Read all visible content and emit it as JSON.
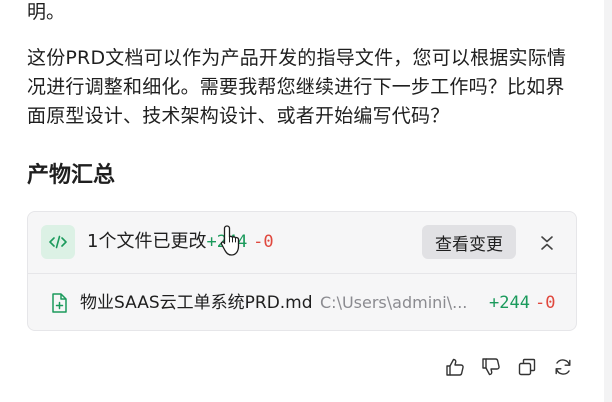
{
  "message": {
    "line_top": "明。",
    "paragraph": "这份PRD文档可以作为产品开发的指导文件，您可以根据实际情况进行调整和细化。需要我帮您继续进行下一步工作吗？比如界面原型设计、技术架构设计、或者开始编写代码？",
    "heading": "产物汇总"
  },
  "card": {
    "summary_text": "1个文件已更改",
    "additions": "+244",
    "deletions": "-0",
    "view_changes_label": "查看变更",
    "icons": {
      "badge": "code-icon",
      "collapse": "chevrons-collapse-icon"
    }
  },
  "files": [
    {
      "name": "物业SAAS云工单系统PRD.md",
      "path": "C:\\Users\\admini\\...",
      "additions": "+244",
      "deletions": "-0",
      "icon": "file-plus-icon"
    }
  ],
  "actions": [
    {
      "icon": "thumbs-up-icon"
    },
    {
      "icon": "thumbs-down-icon"
    },
    {
      "icon": "copy-icon"
    },
    {
      "icon": "refresh-icon"
    }
  ],
  "colors": {
    "add": "#1b9a5c",
    "delete": "#e0483e",
    "badge_bg": "#dcf1e5",
    "card_bg": "#f6f6f7"
  }
}
